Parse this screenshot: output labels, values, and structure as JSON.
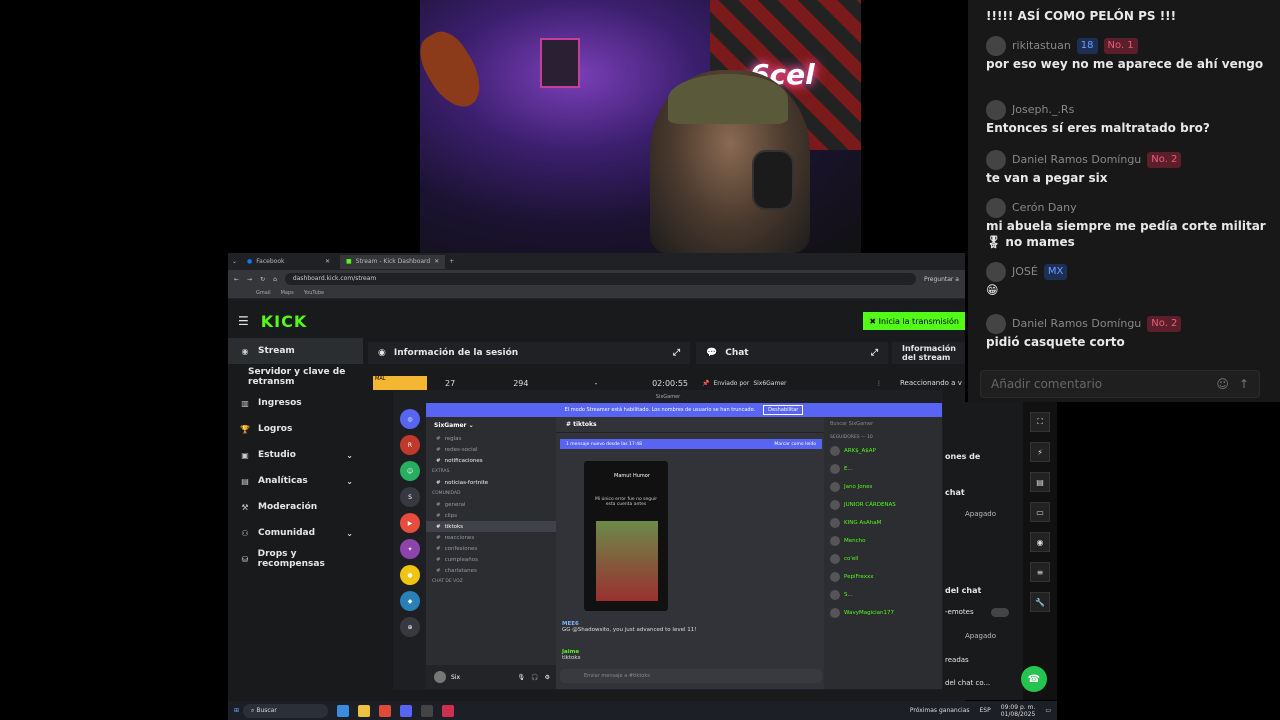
{
  "browser": {
    "tabs": [
      {
        "label": "Facebook"
      },
      {
        "label": "Stream - Kick Dashboard"
      }
    ],
    "url": "dashboard.kick.com/stream",
    "ask_label": "Preguntar a",
    "bookmarks": [
      "Gmail",
      "Maps",
      "YouTube"
    ]
  },
  "kick": {
    "logo": "KICK",
    "go_live": "Inicia la transmisión",
    "nav": [
      {
        "label": "Stream",
        "icon": "stream-icon"
      },
      {
        "label": "Servidor y clave de retransm",
        "icon": ""
      },
      {
        "label": "Ingresos",
        "icon": "bar-chart-icon"
      },
      {
        "label": "Logros",
        "icon": "trophy-icon"
      },
      {
        "label": "Estudio",
        "icon": "studio-icon"
      },
      {
        "label": "Analíticas",
        "icon": "analytics-icon"
      },
      {
        "label": "Moderación",
        "icon": "gavel-icon"
      },
      {
        "label": "Comunidad",
        "icon": "community-icon"
      },
      {
        "label": "Drops y recompensas",
        "icon": "gift-icon"
      }
    ],
    "session_title": "Información de la sesión",
    "session_values": {
      "a": "27",
      "b": "294",
      "c": "-",
      "time": "02:00:55"
    },
    "chat_title": "Chat",
    "sent_by": "Enviado por",
    "sent_by_user": "Six6Gamer",
    "info_title": "Información del stream",
    "reacting": "Reaccionando a v",
    "right_labels": {
      "a": "ones de",
      "b": "chat",
      "c": "del chat",
      "d": "-emotes",
      "e": "readas",
      "f": "del chat co...",
      "off": "Apagado"
    }
  },
  "discord": {
    "window_title": "SixGamer",
    "banner": "El modo Streamer está habilitado. Los nombres de usuario se han truncado.",
    "banner_btn": "Deshabilitar",
    "guild": "SixGamer",
    "channels": [
      {
        "label": "reglas",
        "type": "ch"
      },
      {
        "label": "redes-social",
        "type": "ch"
      },
      {
        "label": "notificaciones",
        "type": "bold"
      },
      {
        "label": "EXTRAS",
        "type": "cat"
      },
      {
        "label": "noticias-fortnite",
        "type": "bold"
      },
      {
        "label": "COMUNIDAD",
        "type": "cat"
      },
      {
        "label": "general",
        "type": "ch"
      },
      {
        "label": "clips",
        "type": "ch"
      },
      {
        "label": "tiktoks",
        "type": "sel"
      },
      {
        "label": "reacciones",
        "type": "ch"
      },
      {
        "label": "confesiones",
        "type": "ch"
      },
      {
        "label": "cumpleaños",
        "type": "ch"
      },
      {
        "label": "charlatanes",
        "type": "ch"
      },
      {
        "label": "CHAT DE VOZ",
        "type": "cat"
      }
    ],
    "user": "Six",
    "channel_title": "tiktoks",
    "new_msg": "1 mensaje nuevo desde las 17:48",
    "mark_read": "Marcar como leído",
    "embed_name": "Mamut Humor",
    "embed_text": "Mi único error fue no seguir esta cuenta antes",
    "msg1_author": "MEE6",
    "msg1_text": "GG @Shadowsito, you just advanced to level 11!",
    "msg2_author": "Jaime",
    "msg2_text": "tiktoks",
    "input_placeholder": "Enviar mensaje a #tiktoks",
    "search": "Buscar SixGamer",
    "members_head": "SEGUIDORES — 10",
    "members": [
      "ARK$_A$AP",
      "E...",
      "Jano Jones",
      "JUNIOR CÁRDENAS",
      "KING AsAhaM",
      "Mencho",
      "co'ell",
      "PepiFrexxx",
      "S...",
      "WavyMagician177"
    ]
  },
  "chat": {
    "messages": [
      {
        "user": "",
        "badges": [],
        "text": "!!!!! ASÍ COMO PELÓN PS !!!"
      },
      {
        "user": "rikitastuan",
        "badges": [
          "18",
          "No. 1"
        ],
        "text": "por eso wey no me aparece de ahí vengo"
      },
      {
        "user": "Joseph._.Rs",
        "badges": [],
        "text": "Entonces sí eres maltratado bro?"
      },
      {
        "user": "Daniel Ramos Domíngu",
        "badges": [
          "No. 2"
        ],
        "text": "te van a pegar six"
      },
      {
        "user": "Cerón Dany",
        "badges": [],
        "text": "mi abuela siempre me pedía corte militar 🎖 no mames"
      },
      {
        "user": "JOSÉ",
        "badges": [
          "MX"
        ],
        "text": "😁"
      },
      {
        "user": "Daniel Ramos Domíngu",
        "badges": [
          "No. 2"
        ],
        "text": "pidió casquete corto"
      }
    ],
    "input_placeholder": "Añadir comentario"
  },
  "taskbar": {
    "search": "Buscar",
    "news": "Próximas ganancias",
    "lang": "ESP",
    "time": "09:09 p. m.",
    "date": "01/08/2025"
  }
}
